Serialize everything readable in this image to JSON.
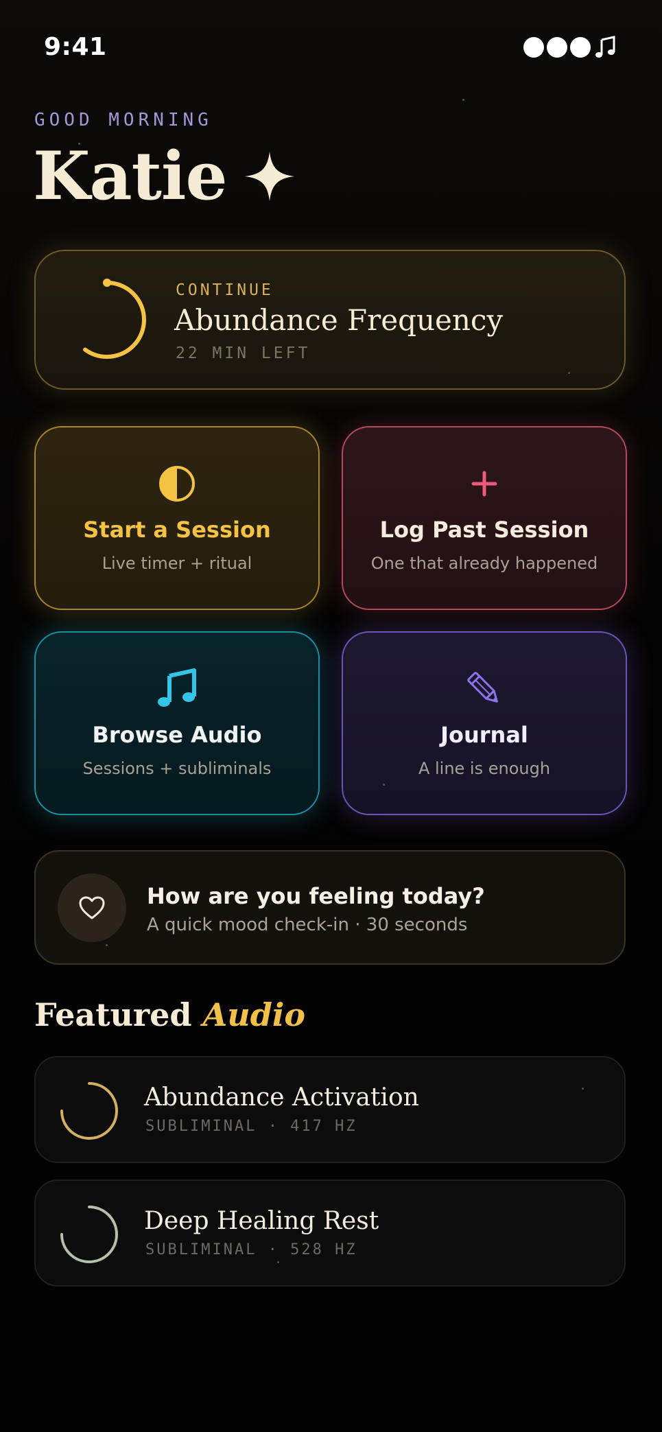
{
  "status_bar": {
    "time": "9:41",
    "music_icon": "music-note-icon"
  },
  "greeting": {
    "label": "GOOD MORNING",
    "name": "Katie",
    "icon": "sparkle-icon"
  },
  "continue": {
    "label": "CONTINUE",
    "title": "Abundance Frequency",
    "meta": "22 MIN LEFT",
    "progress": 0.6,
    "accent": "#f4c343"
  },
  "tiles": [
    {
      "title": "Start a Session",
      "subtitle": "Live timer + ritual",
      "icon": "half-moon-icon",
      "color": "#f4c343"
    },
    {
      "title": "Log Past Session",
      "subtitle": "One that already happened",
      "icon": "plus-icon",
      "color": "#ea5a7c"
    },
    {
      "title": "Browse Audio",
      "subtitle": "Sessions + subliminals",
      "icon": "music-note-icon",
      "color": "#33c6e6"
    },
    {
      "title": "Journal",
      "subtitle": "A line is enough",
      "icon": "pencil-icon",
      "color": "#8d72e8"
    }
  ],
  "mood": {
    "title": "How are you feeling today?",
    "subtitle": "A quick mood check-in · 30 seconds",
    "icon": "heart-icon"
  },
  "featured": {
    "heading": "Featured",
    "heading_accent": "Audio",
    "items": [
      {
        "title": "Abundance Activation",
        "meta": "SUBLIMINAL · 417 HZ",
        "ring_color": "#d1b061"
      },
      {
        "title": "Deep Healing Rest",
        "meta": "SUBLIMINAL · 528 HZ",
        "ring_color": "#b5c0a9"
      }
    ]
  }
}
